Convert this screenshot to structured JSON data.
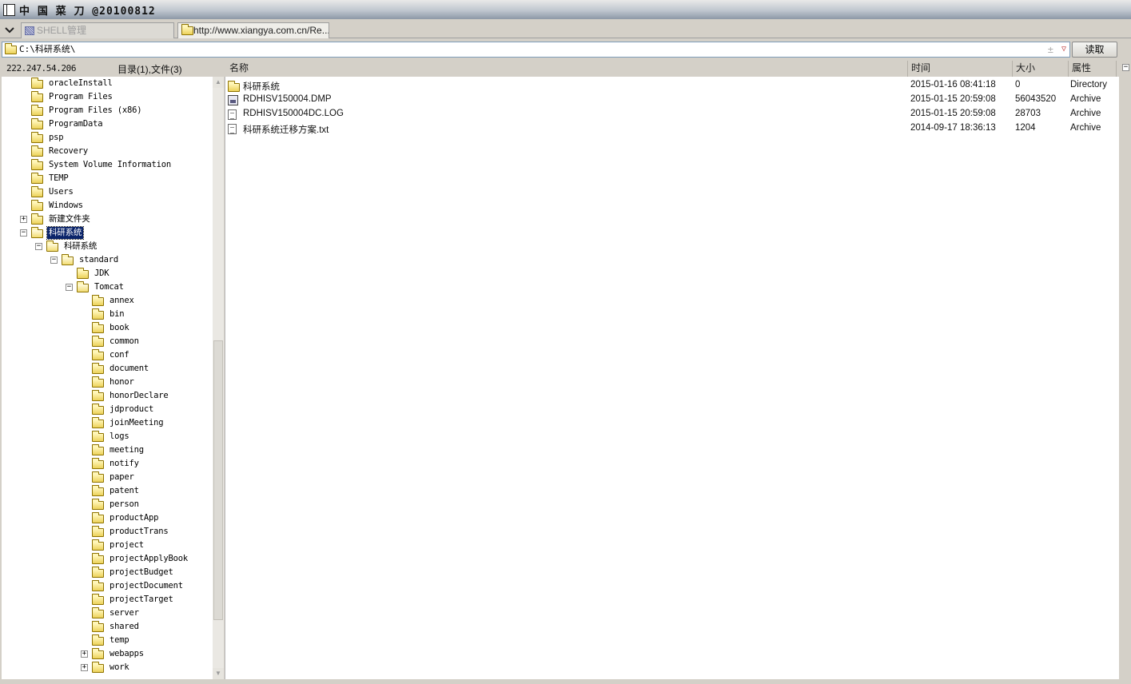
{
  "window": {
    "title": "中 国 菜 刀 @20100812"
  },
  "tabs": [
    {
      "label": "SHELL管理",
      "active": false
    },
    {
      "label": "http://www.xiangya.com.cn/Re...",
      "active": true
    }
  ],
  "address": {
    "path": "C:\\科研系统\\",
    "read_label": "读取",
    "plus_glyph": "±",
    "dropdown_glyph": "▽"
  },
  "status": {
    "ip": "222.247.54.206",
    "counts": "目录(1),文件(3)"
  },
  "columns": {
    "name": "名称",
    "time": "时间",
    "size": "大小",
    "attr": "属性"
  },
  "files": [
    {
      "name": "科研系统",
      "time": "2015-01-16 08:41:18",
      "size": "0",
      "attr": "Directory",
      "icon": "folder-icon"
    },
    {
      "name": "RDHISV150004.DMP",
      "time": "2015-01-15 20:59:08",
      "size": "56043520",
      "attr": "Archive",
      "icon": "dump-file-icon"
    },
    {
      "name": "RDHISV150004DC.LOG",
      "time": "2015-01-15 20:59:08",
      "size": "28703",
      "attr": "Archive",
      "icon": "text-file-icon"
    },
    {
      "name": "科研系统迁移方案.txt",
      "time": "2014-09-17 18:36:13",
      "size": "1204",
      "attr": "Archive",
      "icon": "text-file-icon"
    }
  ],
  "tree": [
    {
      "label": "oracleInstall",
      "depth": 0
    },
    {
      "label": "Program Files",
      "depth": 0
    },
    {
      "label": "Program Files (x86)",
      "depth": 0
    },
    {
      "label": "ProgramData",
      "depth": 0
    },
    {
      "label": "psp",
      "depth": 0
    },
    {
      "label": "Recovery",
      "depth": 0
    },
    {
      "label": "System Volume Information",
      "depth": 0
    },
    {
      "label": "TEMP",
      "depth": 0
    },
    {
      "label": "Users",
      "depth": 0
    },
    {
      "label": "Windows",
      "depth": 0
    },
    {
      "label": "新建文件夹",
      "depth": 0,
      "expander": "+"
    },
    {
      "label": "科研系统",
      "depth": 0,
      "expander": "-",
      "open": true,
      "selected": true
    },
    {
      "label": "科研系统",
      "depth": 1,
      "expander": "-",
      "open": true
    },
    {
      "label": "standard",
      "depth": 2,
      "expander": "-",
      "open": true
    },
    {
      "label": "JDK",
      "depth": 3
    },
    {
      "label": "Tomcat",
      "depth": 3,
      "expander": "-",
      "open": true
    },
    {
      "label": "annex",
      "depth": 4
    },
    {
      "label": "bin",
      "depth": 4
    },
    {
      "label": "book",
      "depth": 4
    },
    {
      "label": "common",
      "depth": 4
    },
    {
      "label": "conf",
      "depth": 4
    },
    {
      "label": "document",
      "depth": 4
    },
    {
      "label": "honor",
      "depth": 4
    },
    {
      "label": "honorDeclare",
      "depth": 4
    },
    {
      "label": "jdproduct",
      "depth": 4
    },
    {
      "label": "joinMeeting",
      "depth": 4
    },
    {
      "label": "logs",
      "depth": 4
    },
    {
      "label": "meeting",
      "depth": 4
    },
    {
      "label": "notify",
      "depth": 4
    },
    {
      "label": "paper",
      "depth": 4
    },
    {
      "label": "patent",
      "depth": 4
    },
    {
      "label": "person",
      "depth": 4
    },
    {
      "label": "productApp",
      "depth": 4
    },
    {
      "label": "productTrans",
      "depth": 4
    },
    {
      "label": "project",
      "depth": 4
    },
    {
      "label": "projectApplyBook",
      "depth": 4
    },
    {
      "label": "projectBudget",
      "depth": 4
    },
    {
      "label": "projectDocument",
      "depth": 4
    },
    {
      "label": "projectTarget",
      "depth": 4
    },
    {
      "label": "server",
      "depth": 4
    },
    {
      "label": "shared",
      "depth": 4
    },
    {
      "label": "temp",
      "depth": 4
    },
    {
      "label": "webapps",
      "depth": 4,
      "expander": "+"
    },
    {
      "label": "work",
      "depth": 4,
      "expander": "+"
    }
  ],
  "icons": {
    "tab_menu": "chevron-down-icon",
    "scroll_up": "▲",
    "scroll_down": "▼",
    "panel_toggle": "−"
  }
}
